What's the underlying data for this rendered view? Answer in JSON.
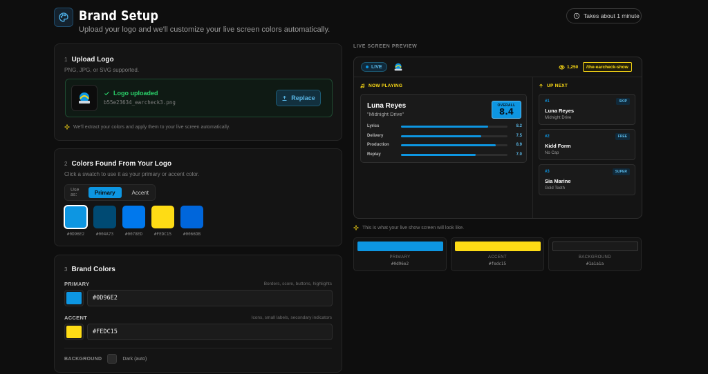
{
  "header": {
    "title": "Brand Setup",
    "subtitle": "Upload your logo and we'll customize your live screen colors automatically.",
    "time_estimate": "Takes about 1 minute"
  },
  "upload": {
    "step": "1",
    "title": "Upload Logo",
    "desc": "PNG, JPG, or SVG supported.",
    "status": "Logo uploaded",
    "filename": "b55e23634_earcheck3.png",
    "replace_label": "Replace",
    "hint": "We'll extract your colors and apply them to your live screen automatically."
  },
  "found": {
    "step": "2",
    "title": "Colors Found From Your Logo",
    "desc": "Click a swatch to use it as your primary or accent color.",
    "use_as": "Use as:",
    "primary_tab": "Primary",
    "accent_tab": "Accent",
    "swatches": [
      {
        "hex": "#0D96E2",
        "color": "#0d96e2"
      },
      {
        "hex": "#004A73",
        "color": "#004a73"
      },
      {
        "hex": "#0078ED",
        "color": "#0078ed"
      },
      {
        "hex": "#FEDC15",
        "color": "#fedc15"
      },
      {
        "hex": "#0066DB",
        "color": "#0066db"
      }
    ]
  },
  "brand": {
    "step": "3",
    "title": "Brand Colors",
    "primary_label": "PRIMARY",
    "primary_note": "Borders, score, buttons, highlights",
    "primary_value": "#0D96E2",
    "primary_color": "#0d96e2",
    "accent_label": "ACCENT",
    "accent_note": "Icons, small labels, secondary indicators",
    "accent_value": "#FEDC15",
    "accent_color": "#fedc15",
    "background_label": "BACKGROUND",
    "background_value": "Dark (auto)"
  },
  "preview": {
    "section_label": "LIVE SCREEN PREVIEW",
    "live": "LIVE",
    "viewers": "1,250",
    "handle": "/the-earcheck-show",
    "now_playing": "NOW PLAYING",
    "up_next": "UP NEXT",
    "current": {
      "artist": "Luna Reyes",
      "song": "\"Midnight Drive\"",
      "overall_label": "OVERALL",
      "overall": "8.4",
      "scores": [
        {
          "name": "Lyrics",
          "value": "8.2",
          "pct": 82
        },
        {
          "name": "Delivery",
          "value": "7.5",
          "pct": 75
        },
        {
          "name": "Production",
          "value": "8.9",
          "pct": 89
        },
        {
          "name": "Replay",
          "value": "7.0",
          "pct": 70
        }
      ]
    },
    "queue": [
      {
        "num": "#1",
        "badge": "SKIP",
        "artist": "Luna Reyes",
        "song": "Midnight Drive"
      },
      {
        "num": "#2",
        "badge": "FREE",
        "artist": "Kidd Form",
        "song": "No Cap"
      },
      {
        "num": "#3",
        "badge": "SUPER",
        "artist": "Sia Marine",
        "song": "Gold Teeth"
      }
    ],
    "hint": "This is what your live show screen will look like.",
    "palette": [
      {
        "name": "PRIMARY",
        "hex": "#0d96e2",
        "color": "#0d96e2"
      },
      {
        "name": "ACCENT",
        "hex": "#fedc15",
        "color": "#fedc15"
      },
      {
        "name": "BACKGROUND",
        "hex": "#1a1a1a",
        "color": "#1a1a1a"
      }
    ]
  }
}
